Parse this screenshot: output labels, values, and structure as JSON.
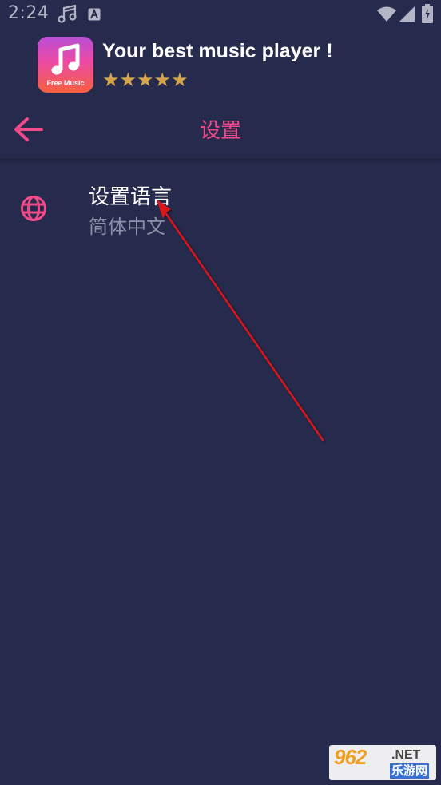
{
  "status_bar": {
    "time": "2:24",
    "icons": [
      "music-note-icon",
      "a-icon",
      "wifi-icon",
      "signal-icon",
      "battery-icon"
    ]
  },
  "ad": {
    "logo_text": "Free Music",
    "title": "Your best music player !",
    "stars": "★★★★★",
    "star_color": "#d4a44b"
  },
  "toolbar": {
    "title": "设置",
    "accent_color": "#f2498a"
  },
  "settings": {
    "language": {
      "title": "设置语言",
      "value": "简体中文",
      "icon": "globe-icon"
    }
  },
  "watermark": {
    "number": "962",
    "net": ".NET",
    "cn": "乐游网"
  },
  "colors": {
    "background": "#262a4c",
    "accent": "#f2498a",
    "annotation": "#d8121c"
  }
}
